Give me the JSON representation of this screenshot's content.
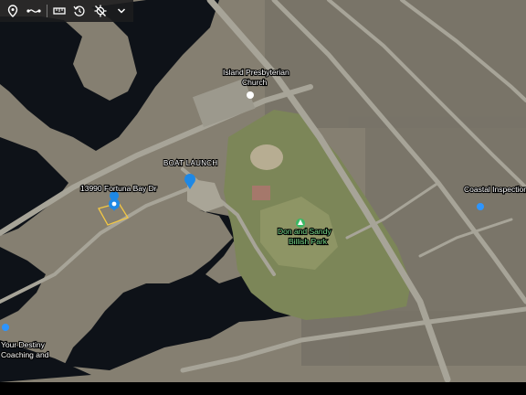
{
  "toolbar": {
    "items": [
      {
        "name": "location-pin-icon"
      },
      {
        "name": "route-icon"
      },
      {
        "name": "ruler-icon"
      },
      {
        "name": "history-icon"
      },
      {
        "name": "no-gps-icon"
      },
      {
        "name": "chevron-down-icon"
      }
    ]
  },
  "places": {
    "church_line1": "Island Presbyterian",
    "church_line2": "Church",
    "boat_launch": "BOAT LAUNCH",
    "address": "13990 Fortuna Bay Dr",
    "park_line1": "Don and Sandy",
    "park_line2": "Billish Park",
    "business_right": "Coastal Inspections",
    "business_left_line1": "Your Destiny",
    "business_left_line2": "Coaching and"
  },
  "colors": {
    "water": "#0d1015",
    "land": "#8a8576",
    "park": "#7f8a5c",
    "road": "#a8a59a",
    "pin": "#1e88e5",
    "parcel_outline": "#f2c744"
  }
}
